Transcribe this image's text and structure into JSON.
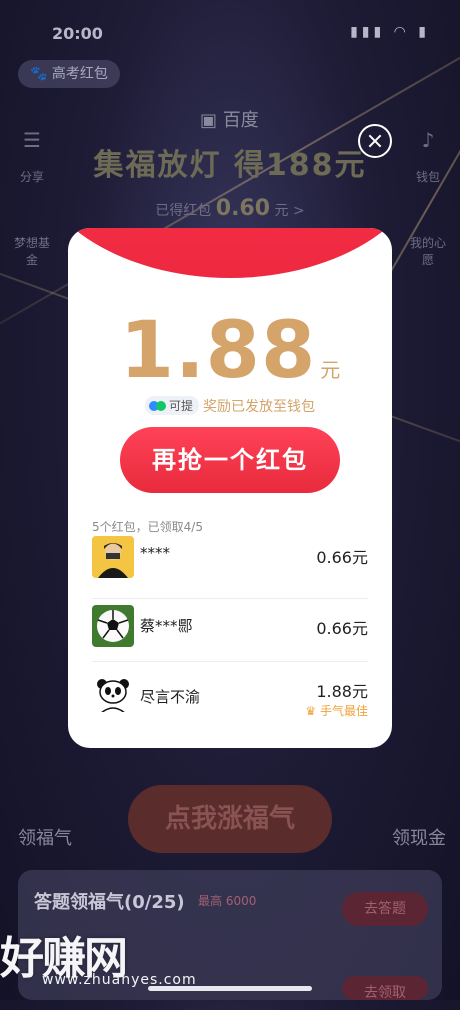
{
  "status": {
    "time": "20:00",
    "icons": "▮▮▮ ◠ ▮"
  },
  "background": {
    "mini_tag": "高考红包",
    "logo": "百度",
    "headline": "集福放灯 得188元",
    "earned_label": "已得红包",
    "earned_value": "0.60",
    "earned_unit": "元 >",
    "left_labels": [
      "分享",
      "梦想基金"
    ],
    "right_labels": [
      "钱包",
      "我的心愿"
    ],
    "bottom_left": "领福气",
    "bottom_right": "领现金",
    "center_button": "点我涨福气",
    "task_title": "答题领福气(0/25)",
    "task_reward": "最高 6000",
    "task_button": "去答题",
    "task_button_2": "去领取"
  },
  "modal": {
    "amount": "1.88",
    "unit": "元",
    "withdraw_tag": "可提",
    "reward_note": "奖励已发放至钱包",
    "grab_button": "再抢一个红包",
    "progress": "5个红包，已领取4/5",
    "rows": [
      {
        "name": "****",
        "amount": "0.66元"
      },
      {
        "name": "蔡***郻",
        "amount": "0.66元"
      },
      {
        "name": "尽言不渝",
        "amount": "1.88元",
        "badge": "手气最佳"
      }
    ]
  },
  "watermark": {
    "text": "好赚网",
    "url": "www.zhuanyes.com"
  },
  "colors": {
    "accent_red": "#ee2840",
    "gold": "#d4a46a",
    "best": "#f0a13a"
  }
}
